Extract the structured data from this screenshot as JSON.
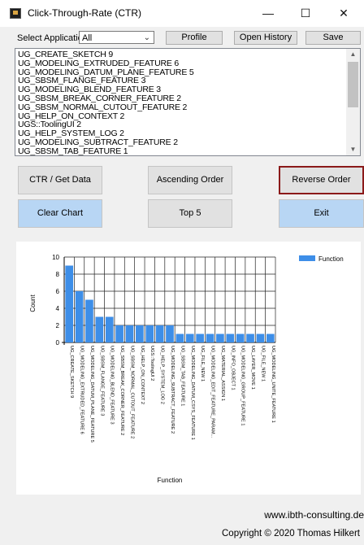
{
  "window": {
    "title": "Click-Through-Rate (CTR)",
    "minimize": "—",
    "maximize": "☐",
    "close": "✕"
  },
  "toolbar": {
    "select_label": "Select Application:",
    "select_value": "All",
    "profile_label": "Profile",
    "open_history_label": "Open History",
    "save_label": "Save"
  },
  "list": {
    "items": [
      "UG_CREATE_SKETCH 9",
      "UG_MODELING_EXTRUDED_FEATURE 6",
      "UG_MODELING_DATUM_PLANE_FEATURE 5",
      "UG_SBSM_FLANGE_FEATURE 3",
      "UG_MODELING_BLEND_FEATURE 3",
      "UG_SBSM_BREAK_CORNER_FEATURE 2",
      "UG_SBSM_NORMAL_CUTOUT_FEATURE 2",
      "UG_HELP_ON_CONTEXT 2",
      "UGS::ToolingUI 2",
      "UG_HELP_SYSTEM_LOG 2",
      "UG_MODELING_SUBTRACT_FEATURE 2",
      "UG_SBSM_TAB_FEATURE 1",
      "UG_MODELING_DATUM_CSYS_FEATURE 1"
    ]
  },
  "buttons": {
    "ctr": "CTR  / Get Data",
    "ascending": "Ascending Order",
    "reverse": "Reverse Order",
    "clear": "Clear Chart",
    "top5": "Top 5",
    "exit": "Exit"
  },
  "colors": {
    "bar": "#3d8ee8",
    "blue_button": "#b8d6f4",
    "selected_border": "#8b1a1a"
  },
  "chart_data": {
    "type": "bar",
    "categories": [
      "UG_CREATE_SKETCH 9",
      "UG_MODELING_EXTRUDED_FEATURE 6",
      "UG_MODELING_DATUM_PLANE_FEATURE 5",
      "UG_SBSM_FLANGE_FEATURE 3",
      "UG_MODELING_BLEND_FEATURE 3",
      "UG_SBSM_BREAK_CORNER_FEATURE 2",
      "UG_SBSM_NORMAL_CUTOUT_FEATURE 2",
      "UG_HELP_ON_CONTEXT 2",
      "UGS::ToolingUI 2",
      "UG_HELP_SYSTEM_LOG 2",
      "UG_MODELING_SUBTRACT_FEATURE 2",
      "UG_SBSM_TAB_FEATURE 1",
      "UG_MODELING_DATUM_CSYS_FEATURE 1",
      "UG_FILE_NEW 1",
      "UG_MODELING_EDIT_FEATURE_PARAM...",
      "UG_MATERIAL_ASSIGN 1",
      "UG_INFO_OBJECT 1",
      "UG_MODELING_GROUP_FEATURE 1",
      "UG_LAYER_MOVE 1",
      "UG_FILE_NEW 1",
      "UG_MODELING_UNITE_FEATURE 1"
    ],
    "series": [
      {
        "name": "Function",
        "values": [
          9,
          6,
          5,
          3,
          3,
          2,
          2,
          2,
          2,
          2,
          2,
          1,
          1,
          1,
          1,
          1,
          1,
          1,
          1,
          1,
          1
        ]
      }
    ],
    "ylim": [
      0,
      10
    ],
    "yticks": [
      "0",
      "2",
      "4",
      "6",
      "8",
      "10"
    ],
    "xlabel": "Function",
    "ylabel": "Count",
    "legend_position": "top-right",
    "grid": true
  },
  "footer": {
    "website": "www.ibth-consulting.de",
    "copyright": "Copyright © 2020 Thomas Hilkert"
  }
}
